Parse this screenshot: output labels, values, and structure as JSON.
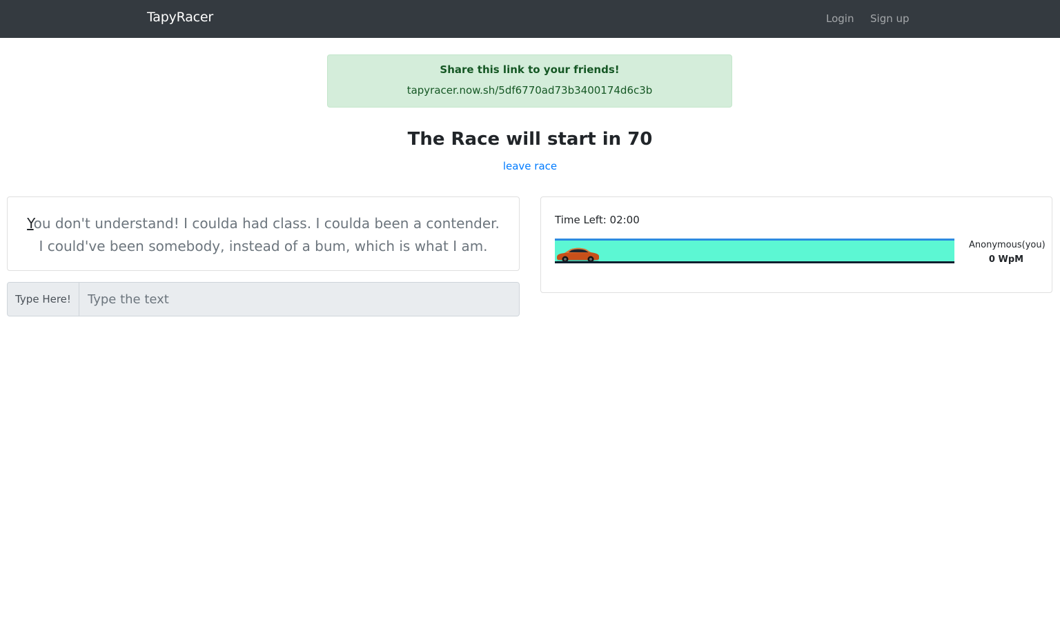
{
  "navbar": {
    "brand": "TapyRacer",
    "login_label": "Login",
    "signup_label": "Sign up"
  },
  "share": {
    "title": "Share this link to your friends!",
    "link": "tapyracer.now.sh/5df6770ad73b3400174d6c3b"
  },
  "race": {
    "countdown_text": "The Race will start in 70",
    "leave_label": "leave race"
  },
  "quote": {
    "current_char": "Y",
    "remaining_text": "ou don't understand! I coulda had class. I coulda been a contender. I could've been somebody, instead of a bum, which is what I am."
  },
  "input": {
    "prepend_label": "Type Here!",
    "placeholder": "Type the text",
    "value": ""
  },
  "race_panel": {
    "time_left": "Time Left: 02:00",
    "racers": [
      {
        "name": "Anonymous(you)",
        "wpm": "0 WpM",
        "progress": 0
      }
    ],
    "car_icon": "car-icon"
  },
  "colors": {
    "navbar_bg": "#343a40",
    "alert_bg": "#d4edda",
    "alert_text": "#155724",
    "link": "#007bff",
    "track_fill": "#5cf7d3",
    "track_top": "#2b8be0",
    "car_body": "#c8501a"
  }
}
